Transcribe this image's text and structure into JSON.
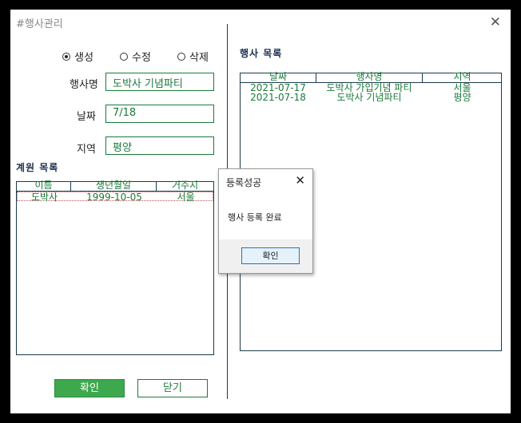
{
  "window": {
    "title": "#행사관리",
    "close_glyph": "✕"
  },
  "mode": {
    "options": [
      {
        "label": "생성",
        "selected": true
      },
      {
        "label": "수정",
        "selected": false
      },
      {
        "label": "삭제",
        "selected": false
      }
    ]
  },
  "form": {
    "name_label": "행사명",
    "name_value": "도박사 기념파티",
    "date_label": "날짜",
    "date_value": "7/18",
    "region_label": "지역",
    "region_value": "평양"
  },
  "members": {
    "title": "계원 목록",
    "columns": [
      "이름",
      "생년월일",
      "거주지"
    ],
    "rows": [
      [
        "도박사",
        "1999-10-05",
        "서울"
      ]
    ]
  },
  "events": {
    "title": "행사 목록",
    "columns": [
      "날짜",
      "행사명",
      "지역"
    ],
    "rows": [
      [
        "2021-07-17",
        "도박사 가입기념 파티",
        "서울"
      ],
      [
        "2021-07-18",
        "도박사 기념파티",
        "평양"
      ]
    ]
  },
  "buttons": {
    "confirm": "확인",
    "close": "닫기"
  },
  "dialog": {
    "title": "등록성공",
    "close_glyph": "✕",
    "message": "행사 등록 완료",
    "ok": "확인"
  },
  "colors": {
    "accent_green": "#1a7a3a",
    "confirm_bg": "#3ea84e"
  }
}
